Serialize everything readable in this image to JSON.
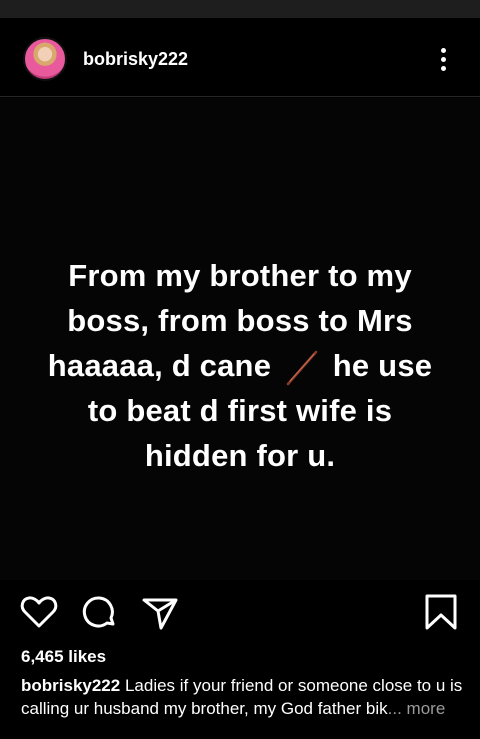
{
  "post": {
    "username": "bobrisky222",
    "text_lines": [
      "From my brother to my",
      "boss, from boss to Mrs",
      "haaaaa, d cane",
      "he use",
      "to beat d first wife is",
      "hidden for u."
    ]
  },
  "icons": {
    "avatar": "profile-avatar",
    "menu": "more-options-icon",
    "cane": "cane-emoji-icon",
    "like": "heart-icon",
    "comment": "comment-icon",
    "share": "send-icon",
    "save": "bookmark-icon"
  },
  "likes": "6,465 likes",
  "caption": {
    "user": "bobrisky222",
    "text": " Ladies if your friend or someone close to u is calling ur husband my brother, my God father bik",
    "ellipsis": "...",
    "more": " more"
  }
}
